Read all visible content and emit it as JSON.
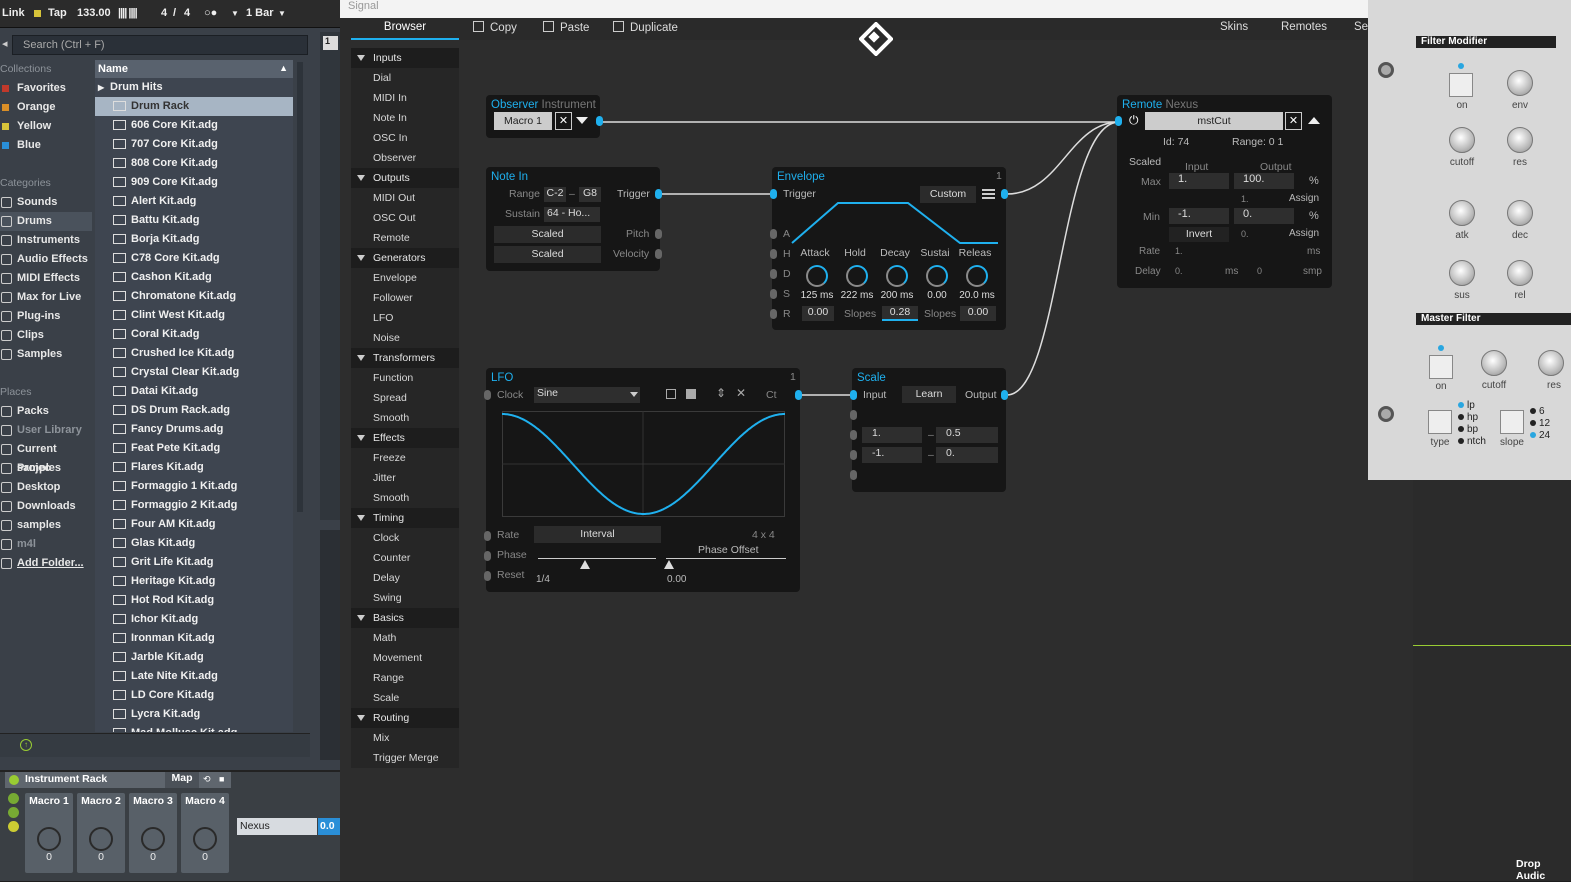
{
  "transport": {
    "link": "Link",
    "tap": "Tap",
    "bpm": "133.00",
    "sig_num": "4",
    "sig_sep": "/",
    "sig_den": "4",
    "quant": "1 Bar"
  },
  "browser": {
    "search_placeholder": "Search (Ctrl + F)",
    "collections_head": "Collections",
    "collections": [
      {
        "label": "Favorites",
        "color": "#c0392b"
      },
      {
        "label": "Orange",
        "color": "#d98e27"
      },
      {
        "label": "Yellow",
        "color": "#d7c43a"
      },
      {
        "label": "Blue",
        "color": "#2a8fd8"
      }
    ],
    "categories_head": "Categories",
    "categories": [
      "Sounds",
      "Drums",
      "Instruments",
      "Audio Effects",
      "MIDI Effects",
      "Max for Live",
      "Plug-ins",
      "Clips",
      "Samples"
    ],
    "places_head": "Places",
    "places": [
      "Packs",
      "User Library",
      "Current Projec",
      "samples",
      "Desktop",
      "Downloads",
      "samples",
      "m4l",
      "Add Folder..."
    ],
    "name_col": "Name",
    "files": [
      "Drum Hits",
      "Drum Rack",
      "606 Core Kit.adg",
      "707 Core Kit.adg",
      "808 Core Kit.adg",
      "909 Core Kit.adg",
      "Alert Kit.adg",
      "Battu Kit.adg",
      "Borja Kit.adg",
      "C78 Core Kit.adg",
      "Cashon Kit.adg",
      "Chromatone Kit.adg",
      "Clint West Kit.adg",
      "Coral Kit.adg",
      "Crushed Ice Kit.adg",
      "Crystal Clear Kit.adg",
      "Datai Kit.adg",
      "DS Drum Rack.adg",
      "Fancy Drums.adg",
      "Feat Pete Kit.adg",
      "Flares Kit.adg",
      "Formaggio 1 Kit.adg",
      "Formaggio 2 Kit.adg",
      "Four AM Kit.adg",
      "Glas Kit.adg",
      "Grit Life Kit.adg",
      "Heritage Kit.adg",
      "Hot Rod Kit.adg",
      "Ichor Kit.adg",
      "Ironman Kit.adg",
      "Jarble Kit.adg",
      "Late Nite Kit.adg",
      "LD Core Kit.adg",
      "Lycra Kit.adg",
      "Mad Mollusc Kit.adg"
    ]
  },
  "rack": {
    "title": "Instrument Rack",
    "map": "Map",
    "macros": [
      {
        "label": "Macro 1",
        "value": "0"
      },
      {
        "label": "Macro 2",
        "value": "0"
      },
      {
        "label": "Macro 3",
        "value": "0"
      },
      {
        "label": "Macro 4",
        "value": "0"
      }
    ],
    "chain_name": "Nexus",
    "chain_val": "0.0"
  },
  "signal": {
    "window_title": "Signal",
    "tab": "Browser",
    "copy": "Copy",
    "paste": "Paste",
    "duplicate": "Duplicate",
    "skins": "Skins",
    "remotes": "Remotes",
    "se": "Se",
    "browser_tree": [
      {
        "cat": "Inputs",
        "items": [
          "Dial",
          "MIDI In",
          "Note In",
          "OSC In",
          "Observer"
        ]
      },
      {
        "cat": "Outputs",
        "items": [
          "MIDI Out",
          "OSC Out",
          "Remote"
        ]
      },
      {
        "cat": "Generators",
        "items": [
          "Envelope",
          "Follower",
          "LFO",
          "Noise"
        ]
      },
      {
        "cat": "Transformers",
        "items": [
          "Function",
          "Spread",
          "Smooth"
        ]
      },
      {
        "cat": "Effects",
        "items": [
          "Freeze",
          "Jitter",
          "Smooth"
        ]
      },
      {
        "cat": "Timing",
        "items": [
          "Clock",
          "Counter",
          "Delay",
          "Swing"
        ]
      },
      {
        "cat": "Basics",
        "items": [
          "Math",
          "Movement",
          "Range",
          "Scale"
        ]
      },
      {
        "cat": "Routing",
        "items": [
          "Mix",
          "Trigger Merge"
        ]
      }
    ],
    "observer": {
      "title": "Observer",
      "sub": "Instrument",
      "value": "Macro 1"
    },
    "notein": {
      "title": "Note In",
      "range_lbl": "Range",
      "range_lo": "C-2",
      "range_dash": "–",
      "range_hi": "G8",
      "trigger": "Trigger",
      "sustain_lbl": "Sustain",
      "sustain_val": "64 - Ho...",
      "scaled1": "Scaled",
      "scaled2": "Scaled",
      "pitch": "Pitch",
      "velocity": "Velocity"
    },
    "envelope": {
      "title": "Envelope",
      "num": "1",
      "trigger": "Trigger",
      "mode": "Custom",
      "a": "A",
      "h": "H",
      "d": "D",
      "s": "S",
      "r": "R",
      "knobs": [
        {
          "label": "Attack",
          "value": "125 ms"
        },
        {
          "label": "Hold",
          "value": "222 ms"
        },
        {
          "label": "Decay",
          "value": "200 ms"
        },
        {
          "label": "Sustai",
          "value": "0.00"
        },
        {
          "label": "Releas",
          "value": "20.0 ms"
        }
      ],
      "r_val": "0.00",
      "slopes1": "Slopes",
      "slope_val": "0.28",
      "slopes2": "Slopes",
      "slope_val2": "0.00"
    },
    "lfo": {
      "title": "LFO",
      "num": "1",
      "clock": "Clock",
      "shape": "Sine",
      "ct": "Ct",
      "rate": "Rate",
      "interval": "Interval",
      "sig": "4  x  4",
      "phase": "Phase",
      "phase_offset": "Phase Offset",
      "reset": "Reset",
      "rate_val": "1/4",
      "offset_val": "0.00"
    },
    "scale": {
      "title": "Scale",
      "input": "Input",
      "learn": "Learn",
      "output": "Output",
      "in_hi": "1.",
      "out_hi": "0.5",
      "in_lo": "-1.",
      "out_lo": "0.",
      "dash": "–"
    },
    "remote": {
      "title": "Remote",
      "sub": "Nexus",
      "param": "mstCut",
      "id": "Id: 74",
      "range": "Range: 0 1",
      "scaled": "Scaled",
      "input": "Input",
      "output": "Output",
      "max": "Max",
      "max_in": "1.",
      "max_out": "100.",
      "pct": "%",
      "assign": "Assign",
      "sub_in": "1.",
      "min": "Min",
      "min_in": "-1.",
      "min_out": "0.",
      "invert": "Invert",
      "sub_in2": "0.",
      "assign2": "Assign",
      "rate": "Rate",
      "rate_in": "1.",
      "ms": "ms",
      "delay": "Delay",
      "delay_in": "0.",
      "ms2": "ms",
      "delay_out": "0",
      "smp": "smp"
    }
  },
  "device": {
    "filter_mod": "Filter Modifier",
    "on": "on",
    "env": "env",
    "cutoff": "cutoff",
    "res": "res",
    "atk": "atk",
    "dec": "dec",
    "sus": "sus",
    "rel": "rel",
    "master_filter": "Master Filter",
    "on2": "on",
    "cutoff2": "cutoff",
    "res2": "res",
    "lp": "lp",
    "hp": "hp",
    "bp": "bp",
    "ntch": "ntch",
    "type": "type",
    "s6": "6",
    "s12": "12",
    "s24": "24",
    "slope": "slope",
    "drop": "Drop Audic"
  }
}
